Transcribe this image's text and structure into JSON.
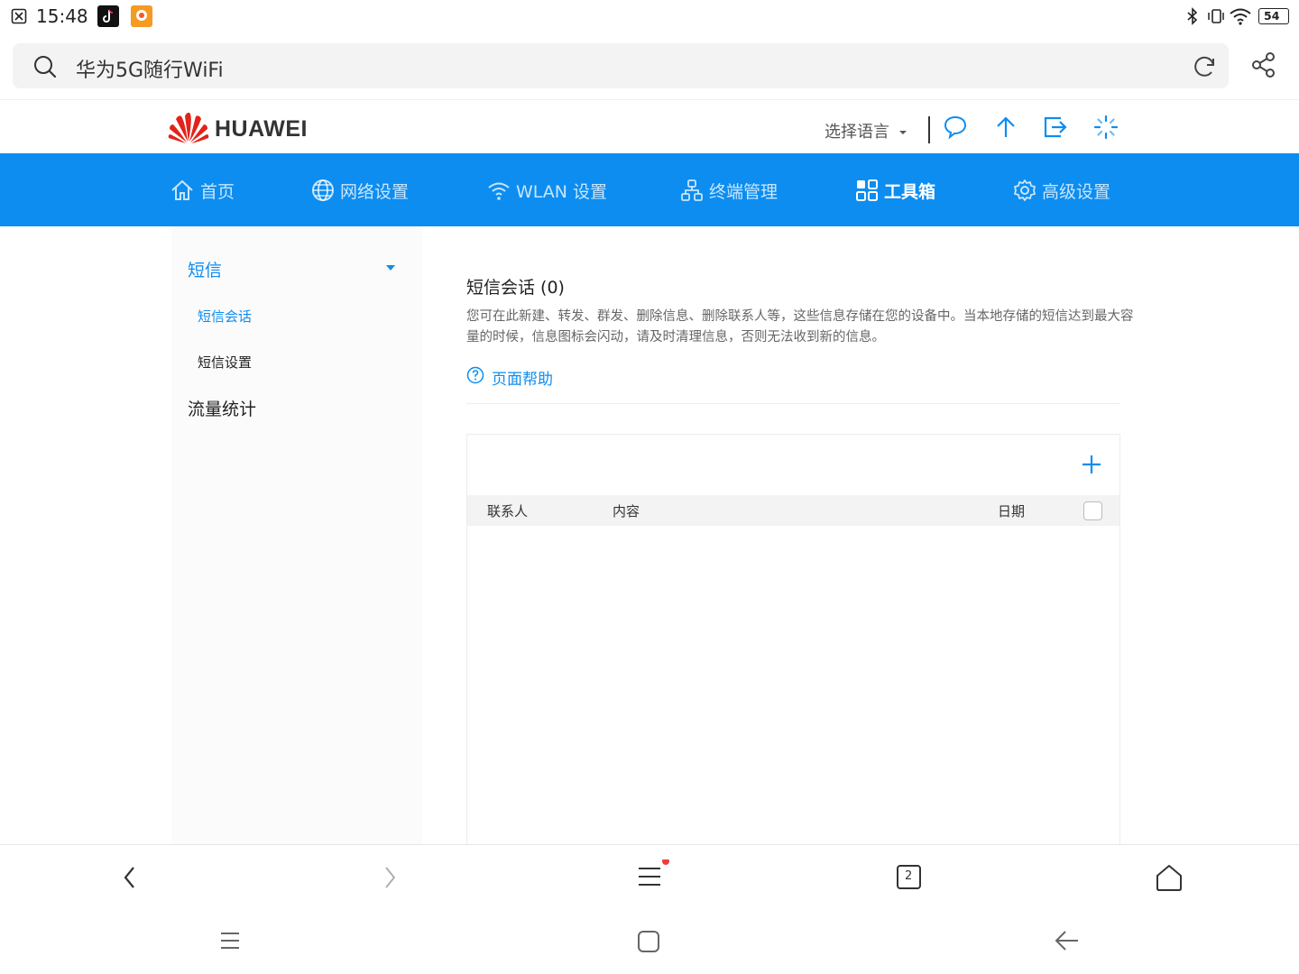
{
  "status_bar": {
    "time": "15:48",
    "battery": "54"
  },
  "browser": {
    "url_text": "华为5G随行WiFi",
    "tab_count": "2"
  },
  "header": {
    "brand": "HUAWEI",
    "language_label": "选择语言"
  },
  "nav": {
    "items": [
      {
        "label": "首页",
        "icon": "home-icon"
      },
      {
        "label": "网络设置",
        "icon": "globe-icon"
      },
      {
        "label": "WLAN 设置",
        "icon": "wifi-icon"
      },
      {
        "label": "终端管理",
        "icon": "devices-icon"
      },
      {
        "label": "工具箱",
        "icon": "toolbox-icon",
        "active": true
      },
      {
        "label": "高级设置",
        "icon": "gear-icon"
      }
    ]
  },
  "sidebar": {
    "group1": "短信",
    "sub1": "短信会话",
    "sub2": "短信设置",
    "group2": "流量统计"
  },
  "main": {
    "title": "短信会话 (0)",
    "description": "您可在此新建、转发、群发、删除信息、删除联系人等，这些信息存储在您的设备中。当本地存储的短信达到最大容量的时候，信息图标会闪动，请及时清理信息，否则无法收到新的信息。",
    "help_link": "页面帮助",
    "table": {
      "col_contact": "联系人",
      "col_content": "内容",
      "col_date": "日期"
    }
  },
  "colors": {
    "primary": "#0d8df0",
    "brand_red": "#e2231a"
  }
}
